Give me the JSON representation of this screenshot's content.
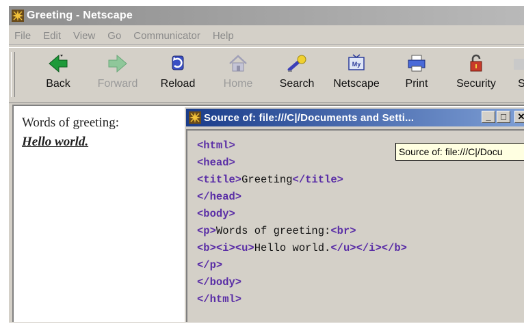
{
  "window": {
    "title": "Greeting - Netscape",
    "icon": "netscape-star-icon"
  },
  "menu": [
    "File",
    "Edit",
    "View",
    "Go",
    "Communicator",
    "Help"
  ],
  "toolbar": [
    {
      "label": "Back",
      "icon": "back-arrow-icon",
      "enabled": true
    },
    {
      "label": "Forward",
      "icon": "forward-arrow-icon",
      "enabled": false
    },
    {
      "label": "Reload",
      "icon": "reload-icon",
      "enabled": true
    },
    {
      "label": "Home",
      "icon": "home-icon",
      "enabled": false
    },
    {
      "label": "Search",
      "icon": "search-icon",
      "enabled": true
    },
    {
      "label": "Netscape",
      "icon": "netscape-icon",
      "enabled": true
    },
    {
      "label": "Print",
      "icon": "print-icon",
      "enabled": true
    },
    {
      "label": "Security",
      "icon": "security-lock-icon",
      "enabled": true
    },
    {
      "label": "S",
      "icon": "toolbar-overflow-icon",
      "enabled": true
    }
  ],
  "page": {
    "line1": "Words of greeting:",
    "line2": "Hello world."
  },
  "source_window": {
    "title": "Source of: file:///C|/Documents and Setti...",
    "buttons": [
      "_",
      "□",
      "✕"
    ],
    "lines": [
      [
        {
          "t": "<html>",
          "tag": true
        }
      ],
      [
        {
          "t": "<head>",
          "tag": true
        }
      ],
      [
        {
          "t": "<title>",
          "tag": true
        },
        {
          "t": "Greeting",
          "tag": false
        },
        {
          "t": "</title>",
          "tag": true
        }
      ],
      [
        {
          "t": "</head>",
          "tag": true
        }
      ],
      [
        {
          "t": "<body>",
          "tag": true
        }
      ],
      [
        {
          "t": "<p>",
          "tag": true
        },
        {
          "t": "Words of greeting:",
          "tag": false
        },
        {
          "t": "<br>",
          "tag": true
        }
      ],
      [
        {
          "t": "<b>",
          "tag": true
        },
        {
          "t": "<i>",
          "tag": true
        },
        {
          "t": "<u>",
          "tag": true
        },
        {
          "t": "Hello world.",
          "tag": false
        },
        {
          "t": "</u>",
          "tag": true
        },
        {
          "t": "</i>",
          "tag": true
        },
        {
          "t": "</b>",
          "tag": true
        }
      ],
      [
        {
          "t": "</p>",
          "tag": true
        }
      ],
      [
        {
          "t": "</body>",
          "tag": true
        }
      ],
      [
        {
          "t": "</html>",
          "tag": true
        }
      ]
    ]
  },
  "tooltip": "Source of: file:///C|/Docu",
  "colors": {
    "tag": "#5a2ea6",
    "source_title": "#1a3c8a",
    "tooltip_bg": "#ffffe1"
  }
}
